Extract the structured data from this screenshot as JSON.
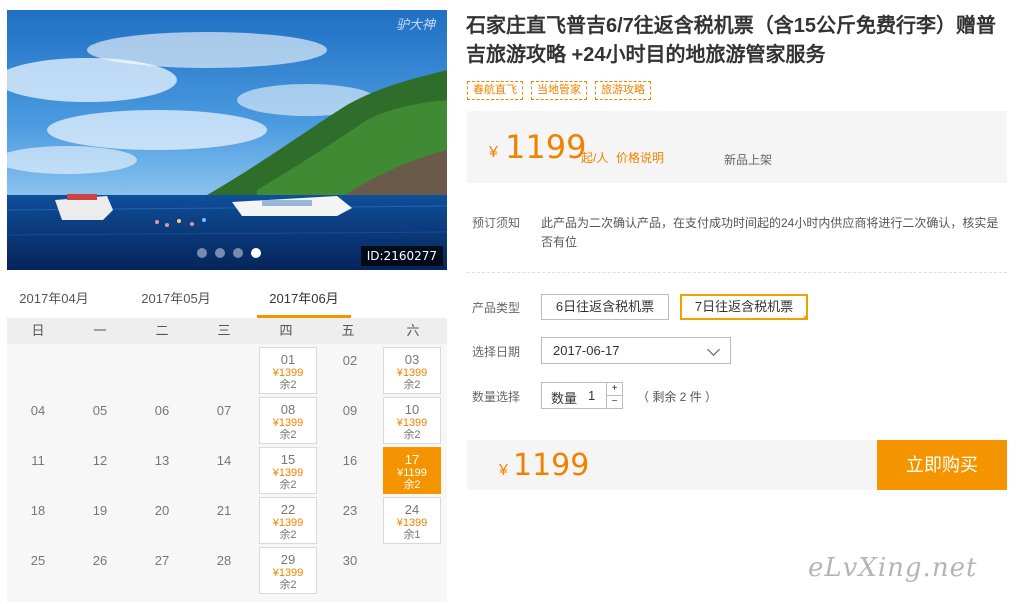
{
  "hero": {
    "watermark": "驴大神",
    "id_label": "ID:2160277",
    "slide_count": 4,
    "active_slide": 4
  },
  "product": {
    "title": "石家庄直飞普吉6/7往返含税机票（含15公斤免费行李）赠普吉旅游攻略 +24小时目的地旅游管家服务",
    "tags": [
      "春航直飞",
      "当地管家",
      "旅游攻略"
    ]
  },
  "price": {
    "currency": "¥",
    "amount": "1199",
    "per": "起/人",
    "explain_link": "价格说明",
    "new_badge": "新品上架"
  },
  "notice": {
    "label": "预订须知",
    "text": "此产品为二次确认产品，在支付成功时间起的24小时内供应商将进行二次确认，核实是否有位"
  },
  "options": {
    "type_label": "产品类型",
    "types": [
      "6日往返含税机票",
      "7日往返含税机票"
    ],
    "selected_type": 1,
    "date_label": "选择日期",
    "date_value": "2017-06-17",
    "qty_label": "数量选择",
    "qty_prefix": "数量",
    "qty_value": "1",
    "qty_plus": "+",
    "qty_minus": "−",
    "remaining": "（ 剩余 2 件 ）"
  },
  "checkout": {
    "currency": "¥",
    "amount": "1199",
    "buy_label": "立即购买"
  },
  "calendar": {
    "months": [
      "2017年04月",
      "2017年05月",
      "2017年06月"
    ],
    "active_month": 2,
    "weekdays": [
      "日",
      "一",
      "二",
      "三",
      "四",
      "五",
      "六"
    ],
    "days": [
      {
        "d": "01",
        "col": 4,
        "row": 0,
        "price": "¥1399",
        "rem": "余2"
      },
      {
        "d": "02",
        "col": 5,
        "row": 0
      },
      {
        "d": "03",
        "col": 6,
        "row": 0,
        "price": "¥1399",
        "rem": "余2"
      },
      {
        "d": "04",
        "col": 0,
        "row": 1
      },
      {
        "d": "05",
        "col": 1,
        "row": 1
      },
      {
        "d": "06",
        "col": 2,
        "row": 1
      },
      {
        "d": "07",
        "col": 3,
        "row": 1
      },
      {
        "d": "08",
        "col": 4,
        "row": 1,
        "price": "¥1399",
        "rem": "余2"
      },
      {
        "d": "09",
        "col": 5,
        "row": 1
      },
      {
        "d": "10",
        "col": 6,
        "row": 1,
        "price": "¥1399",
        "rem": "余2"
      },
      {
        "d": "11",
        "col": 0,
        "row": 2
      },
      {
        "d": "12",
        "col": 1,
        "row": 2
      },
      {
        "d": "13",
        "col": 2,
        "row": 2
      },
      {
        "d": "14",
        "col": 3,
        "row": 2
      },
      {
        "d": "15",
        "col": 4,
        "row": 2,
        "price": "¥1399",
        "rem": "余2"
      },
      {
        "d": "16",
        "col": 5,
        "row": 2
      },
      {
        "d": "17",
        "col": 6,
        "row": 2,
        "price": "¥1199",
        "rem": "余2",
        "selected": true
      },
      {
        "d": "18",
        "col": 0,
        "row": 3
      },
      {
        "d": "19",
        "col": 1,
        "row": 3
      },
      {
        "d": "20",
        "col": 2,
        "row": 3
      },
      {
        "d": "21",
        "col": 3,
        "row": 3
      },
      {
        "d": "22",
        "col": 4,
        "row": 3,
        "price": "¥1399",
        "rem": "余2"
      },
      {
        "d": "23",
        "col": 5,
        "row": 3
      },
      {
        "d": "24",
        "col": 6,
        "row": 3,
        "price": "¥1399",
        "rem": "余1"
      },
      {
        "d": "25",
        "col": 0,
        "row": 4
      },
      {
        "d": "26",
        "col": 1,
        "row": 4
      },
      {
        "d": "27",
        "col": 2,
        "row": 4
      },
      {
        "d": "28",
        "col": 3,
        "row": 4
      },
      {
        "d": "29",
        "col": 4,
        "row": 4,
        "price": "¥1399",
        "rem": "余2"
      },
      {
        "d": "30",
        "col": 5,
        "row": 4
      }
    ]
  },
  "site_watermark": "eLvXing.net",
  "colors": {
    "accent": "#f49500",
    "price": "#f08200",
    "selected_border": "#f0a100"
  }
}
